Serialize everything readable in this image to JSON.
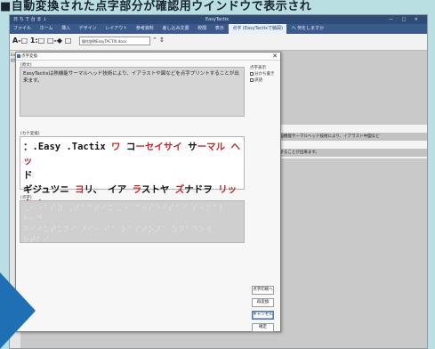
{
  "heading": "■自動変換された点字部分が確認用ウインドウで表示され",
  "app": {
    "title_left": "日 ち で 台 ま ↓",
    "title_center": "EasyTactix",
    "window_controls": "— □ ✕",
    "menu": [
      "ファイル",
      "ホーム",
      "挿入",
      "デザイン",
      "レイアウト",
      "参考資料",
      "差し込み文書",
      "校閲",
      "表示",
      "点字 (EasyTactixで触図)",
      "ヘ 何をしますか"
    ],
    "menu_active_index": 9,
    "zoom_text": "A-□ 1:□ □-◆ □",
    "file_name": "操作説明EasyTACTIX.docx",
    "nav_text": "⌃  ↕",
    "side_labels": [
      "EasyTactix",
      "起動"
    ]
  },
  "document": {
    "lines": [
      "点描機能サーマルヘッド技術により、イアラスト中図など",
      "とすることが出来ます。"
    ]
  },
  "dialog": {
    "title": "点字変換",
    "close": "✕",
    "original_label": "[原文]",
    "original_text": "EasyTactixは熱機能サーマルヘッド技術により、イアラストや図などを点字プリントすることが出来ます。",
    "kana_label": "[カナ変換]",
    "kana_lines": [
      [
        {
          "t": "：.Easy .Tactix ",
          "r": false
        },
        {
          "t": "ワ ",
          "r": true
        },
        {
          "t": "コ",
          "r": false
        },
        {
          "t": "ーセイサイ ",
          "r": true
        },
        {
          "t": "サ",
          "r": false
        },
        {
          "t": "ーマル ヘッ",
          "r": true
        }
      ],
      [
        {
          "t": "ド",
          "r": false
        }
      ],
      [
        {
          "t": "ギ",
          "r": false
        },
        {
          "t": "ジュツニ ",
          "r": false
        },
        {
          "t": "ヨ",
          "r": true
        },
        {
          "t": "リ、 ",
          "r": false
        },
        {
          "t": "イア ",
          "r": false
        },
        {
          "t": "ラ",
          "r": true
        },
        {
          "t": "ストヤ ",
          "r": false
        },
        {
          "t": "ズ",
          "r": true
        },
        {
          "t": "ナドヲ ",
          "r": false
        },
        {
          "t": "リッタイ",
          "r": true
        }
      ],
      [
        {
          "t": "プ",
          "r": false
        },
        {
          "t": "リント ",
          "r": false
        },
        {
          "t": "ス",
          "r": true
        },
        {
          "t": "ル ",
          "r": false
        },
        {
          "t": "コトガ",
          "r": false
        },
        {
          "t": " デ",
          "r": true
        },
        {
          "t": "キマス。",
          "r": false
        }
      ]
    ],
    "braille_label": "[点字]",
    "braille_lines": [
      "⠠⠂⠐⠁⠎⠽ ⠠⠞⠁⠉⠞⠊⠭ ⠄⠂ ⠉⠒⠎⠑⠊⠎⠁⠊ ⠎⠒⠍⠁⠇ ⠓⠂⠙",
      "⠛⠊⠚⠥⠞⠥⠝⠊ ⠜⠊⠂ ⠊⠁ ⠗⠁⠎⠞⠕⠜⠁ ⠵⠝⠁⠙⠕⠺ ⠗⠞⠁⠊",
      "⠫⠗⠊⠝⠞⠕ ⠎⠥⠗⠥ ⠅⠞⠕⠛⠁ ⠙⠑⠅⠊⠍⠁⠎⠥⠲"
    ],
    "options_label": "点字表示",
    "options": [
      "分かち書き",
      "訳語"
    ],
    "buttons": [
      "点字印刷へ",
      "再変換",
      "キャンセル",
      "確定"
    ]
  },
  "colors": {
    "background": "#b9dfe2",
    "titlebar": "#2f4b78",
    "kana_highlight": "#c0292b",
    "arrow": "#1f6fb4"
  }
}
